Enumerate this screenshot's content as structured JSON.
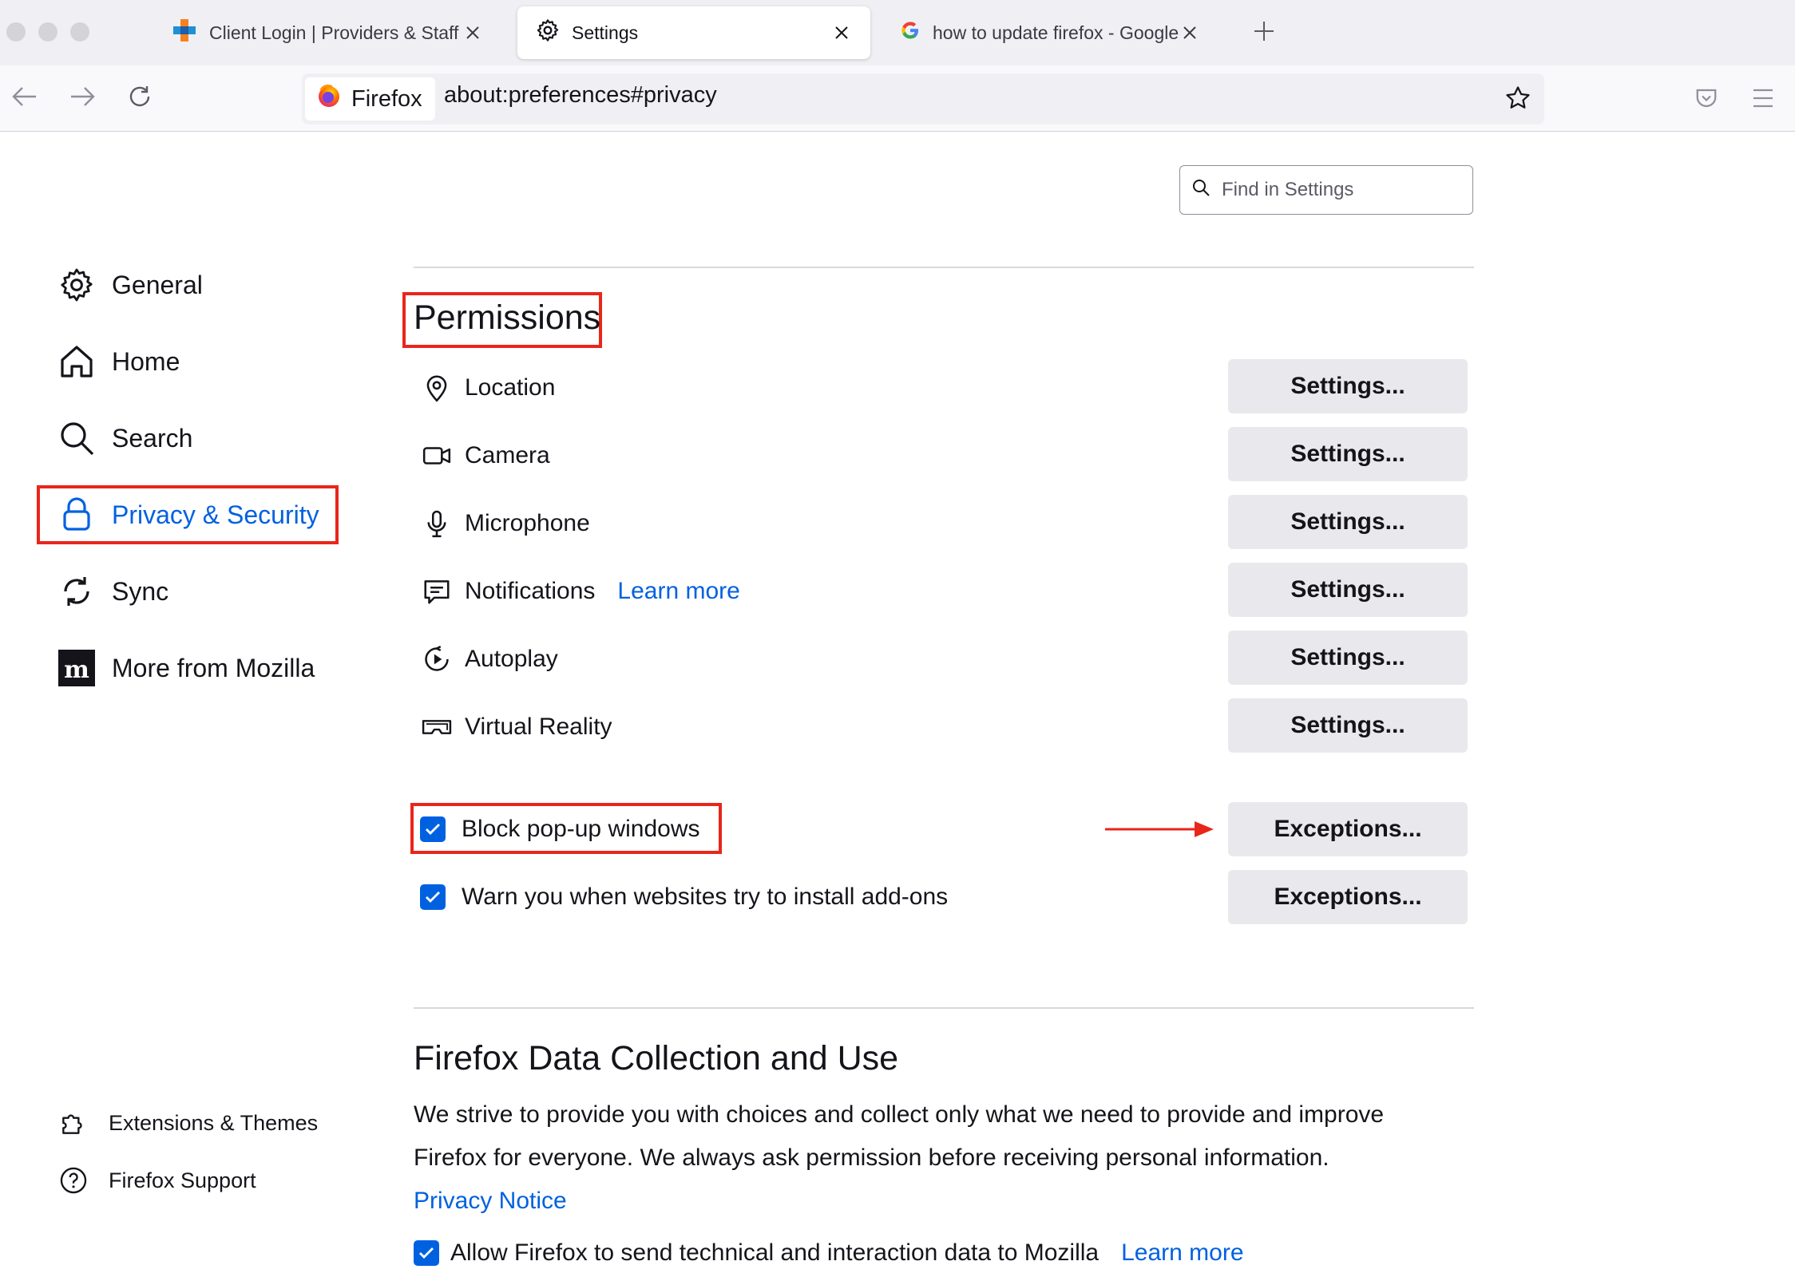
{
  "tabs": [
    {
      "title": "Client Login | Providers & Staff |",
      "icon": "plus-logo-icon",
      "active": false
    },
    {
      "title": "Settings",
      "icon": "gear-icon",
      "active": true
    },
    {
      "title": "how to update firefox - Google S",
      "icon": "google-icon",
      "active": false
    }
  ],
  "urlbar": {
    "identity_label": "Firefox",
    "url": "about:preferences#privacy"
  },
  "search": {
    "placeholder": "Find in Settings"
  },
  "sidebar": {
    "categories": [
      {
        "label": "General",
        "icon": "gear-icon"
      },
      {
        "label": "Home",
        "icon": "home-icon"
      },
      {
        "label": "Search",
        "icon": "search-icon"
      },
      {
        "label": "Privacy & Security",
        "icon": "lock-icon",
        "selected": true
      },
      {
        "label": "Sync",
        "icon": "sync-icon"
      },
      {
        "label": "More from Mozilla",
        "icon": "mozilla-icon"
      }
    ],
    "footer": [
      {
        "label": "Extensions & Themes",
        "icon": "puzzle-icon"
      },
      {
        "label": "Firefox Support",
        "icon": "help-icon"
      }
    ]
  },
  "permissions": {
    "heading": "Permissions",
    "rows": [
      {
        "label": "Location",
        "icon": "location-icon",
        "button": "Settings..."
      },
      {
        "label": "Camera",
        "icon": "camera-icon",
        "button": "Settings..."
      },
      {
        "label": "Microphone",
        "icon": "microphone-icon",
        "button": "Settings..."
      },
      {
        "label": "Notifications",
        "icon": "notifications-icon",
        "button": "Settings...",
        "link": "Learn more"
      },
      {
        "label": "Autoplay",
        "icon": "autoplay-icon",
        "button": "Settings..."
      },
      {
        "label": "Virtual Reality",
        "icon": "vr-icon",
        "button": "Settings..."
      }
    ],
    "block_popups": {
      "label": "Block pop-up windows",
      "checked": true,
      "button": "Exceptions..."
    },
    "warn_addons": {
      "label": "Warn you when websites try to install add-ons",
      "checked": true,
      "button": "Exceptions..."
    }
  },
  "data_collection": {
    "heading": "Firefox Data Collection and Use",
    "line1": "We strive to provide you with choices and collect only what we need to provide and improve",
    "line2": "Firefox for everyone. We always ask permission before receiving personal information.",
    "privacy_link": "Privacy Notice",
    "telemetry": {
      "label": "Allow Firefox to send technical and interaction data to Mozilla",
      "checked": true,
      "link": "Learn more"
    }
  },
  "colors": {
    "accent": "#0061e0",
    "highlight": "#e8261b",
    "button_bg": "#e9e9ed"
  }
}
